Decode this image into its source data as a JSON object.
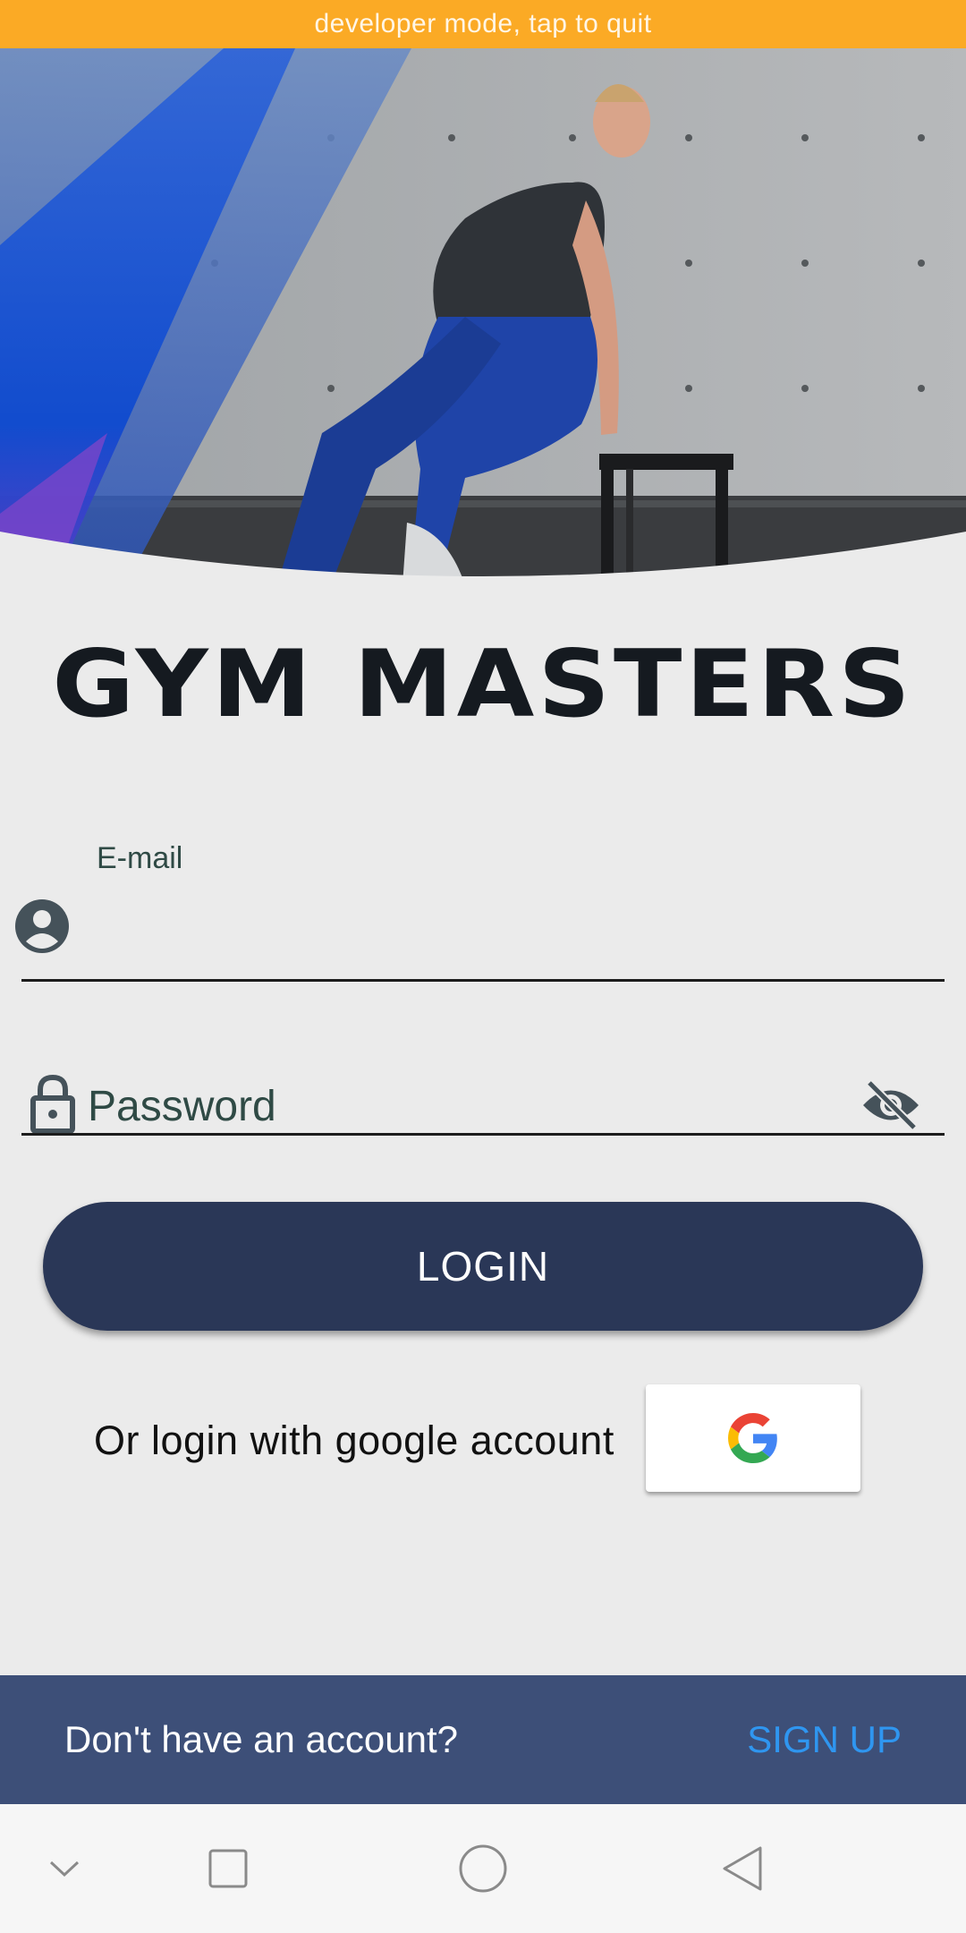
{
  "status_bar": {
    "text": "developer mode, tap to quit"
  },
  "brand": {
    "logo_text": "GYM MASTERS"
  },
  "form": {
    "email_label": "E-mail",
    "email_value": "",
    "password_placeholder": "Password",
    "password_value": "",
    "login_label": "LOGIN"
  },
  "google": {
    "prompt": "Or login with google account"
  },
  "footer": {
    "no_account": "Don't have an account?",
    "signup_label": "SIGN UP"
  },
  "colors": {
    "dev_bar": "#fbaa25",
    "accent_dark": "#2a3757",
    "footer": "#3d4f78",
    "link": "#2f96f0"
  },
  "icons": [
    "person-icon",
    "lock-icon",
    "eye-off-icon",
    "google-icon",
    "nav-down-icon",
    "nav-recents-icon",
    "nav-home-icon",
    "nav-back-icon"
  ]
}
